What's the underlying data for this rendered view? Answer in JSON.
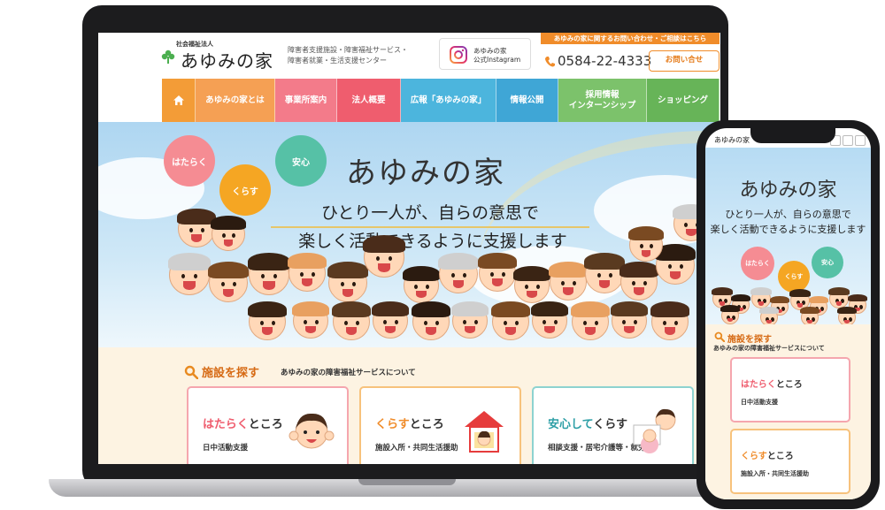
{
  "header": {
    "logo_sub": "社会福祉法人",
    "logo_main": "あゆみの家",
    "tagline": "障害者支援施設・障害福祉サービス・障害者就業・生活支援センター",
    "instagram_line1": "あゆみの家",
    "instagram_line2": "公式Instagram",
    "contact_bar": "あゆみの家に関するお問い合わせ・ご相談はこちら",
    "phone": "0584-22-4333",
    "inquiry_button": "お問い合せ"
  },
  "nav": {
    "items": [
      {
        "label": "あゆみの家とは",
        "color": "#f5a054"
      },
      {
        "label": "事業所案内",
        "color": "#f37b8a"
      },
      {
        "label": "法人概要",
        "color": "#ef5d6e"
      },
      {
        "label": "広報「あゆみの家」",
        "color": "#4cb5dd"
      },
      {
        "label": "情報公開",
        "color": "#3fa6d6"
      },
      {
        "label": "採用情報\nインターンシップ",
        "color": "#7cc26b"
      },
      {
        "label": "ショッピング",
        "color": "#67b458"
      }
    ],
    "home_color": "#f39c37"
  },
  "hero": {
    "bubbles": [
      "はたらく",
      "くらす",
      "安心"
    ],
    "bubble_colors": [
      "#f58c93",
      "#f5a623",
      "#56c1a6"
    ],
    "title": "あゆみの家",
    "line1": "ひとり一人が、自らの意思で",
    "line2": "楽しく活動できるように支援します"
  },
  "services": {
    "title": "施設を探す",
    "subtitle": "あゆみの家の障害福祉サービスについて",
    "cards": [
      {
        "title_accent": "はたらく",
        "title_rest": "ところ",
        "desc": "日中活動支援",
        "accent_color": "#ef5d6e",
        "border_color": "#f5a6ae"
      },
      {
        "title_accent": "くらす",
        "title_rest": "ところ",
        "desc": "施設入所・共同生活援助",
        "accent_color": "#f08c2a",
        "border_color": "#f7c27c"
      },
      {
        "title_accent": "安心して",
        "title_rest": "くらす",
        "desc": "相談支援・居宅介護等・就労",
        "accent_color": "#2e9fa6",
        "border_color": "#8dd3d0"
      }
    ]
  },
  "mobile": {
    "logo": "あゆみの家",
    "title": "あゆみの家",
    "line1": "ひとり一人が、自らの意思で",
    "line2": "楽しく活動できるように支援します",
    "bubbles": [
      "はたらく",
      "くらす",
      "安心"
    ],
    "svc_title": "施設を探す",
    "svc_sub": "あゆみの家の障害福祉サービスについて",
    "cards": [
      {
        "title_accent": "はたらく",
        "title_rest": "ところ",
        "desc": "日中活動支援"
      },
      {
        "title_accent": "くらす",
        "title_rest": "ところ",
        "desc": "施設入所・共同生活援助"
      }
    ]
  }
}
